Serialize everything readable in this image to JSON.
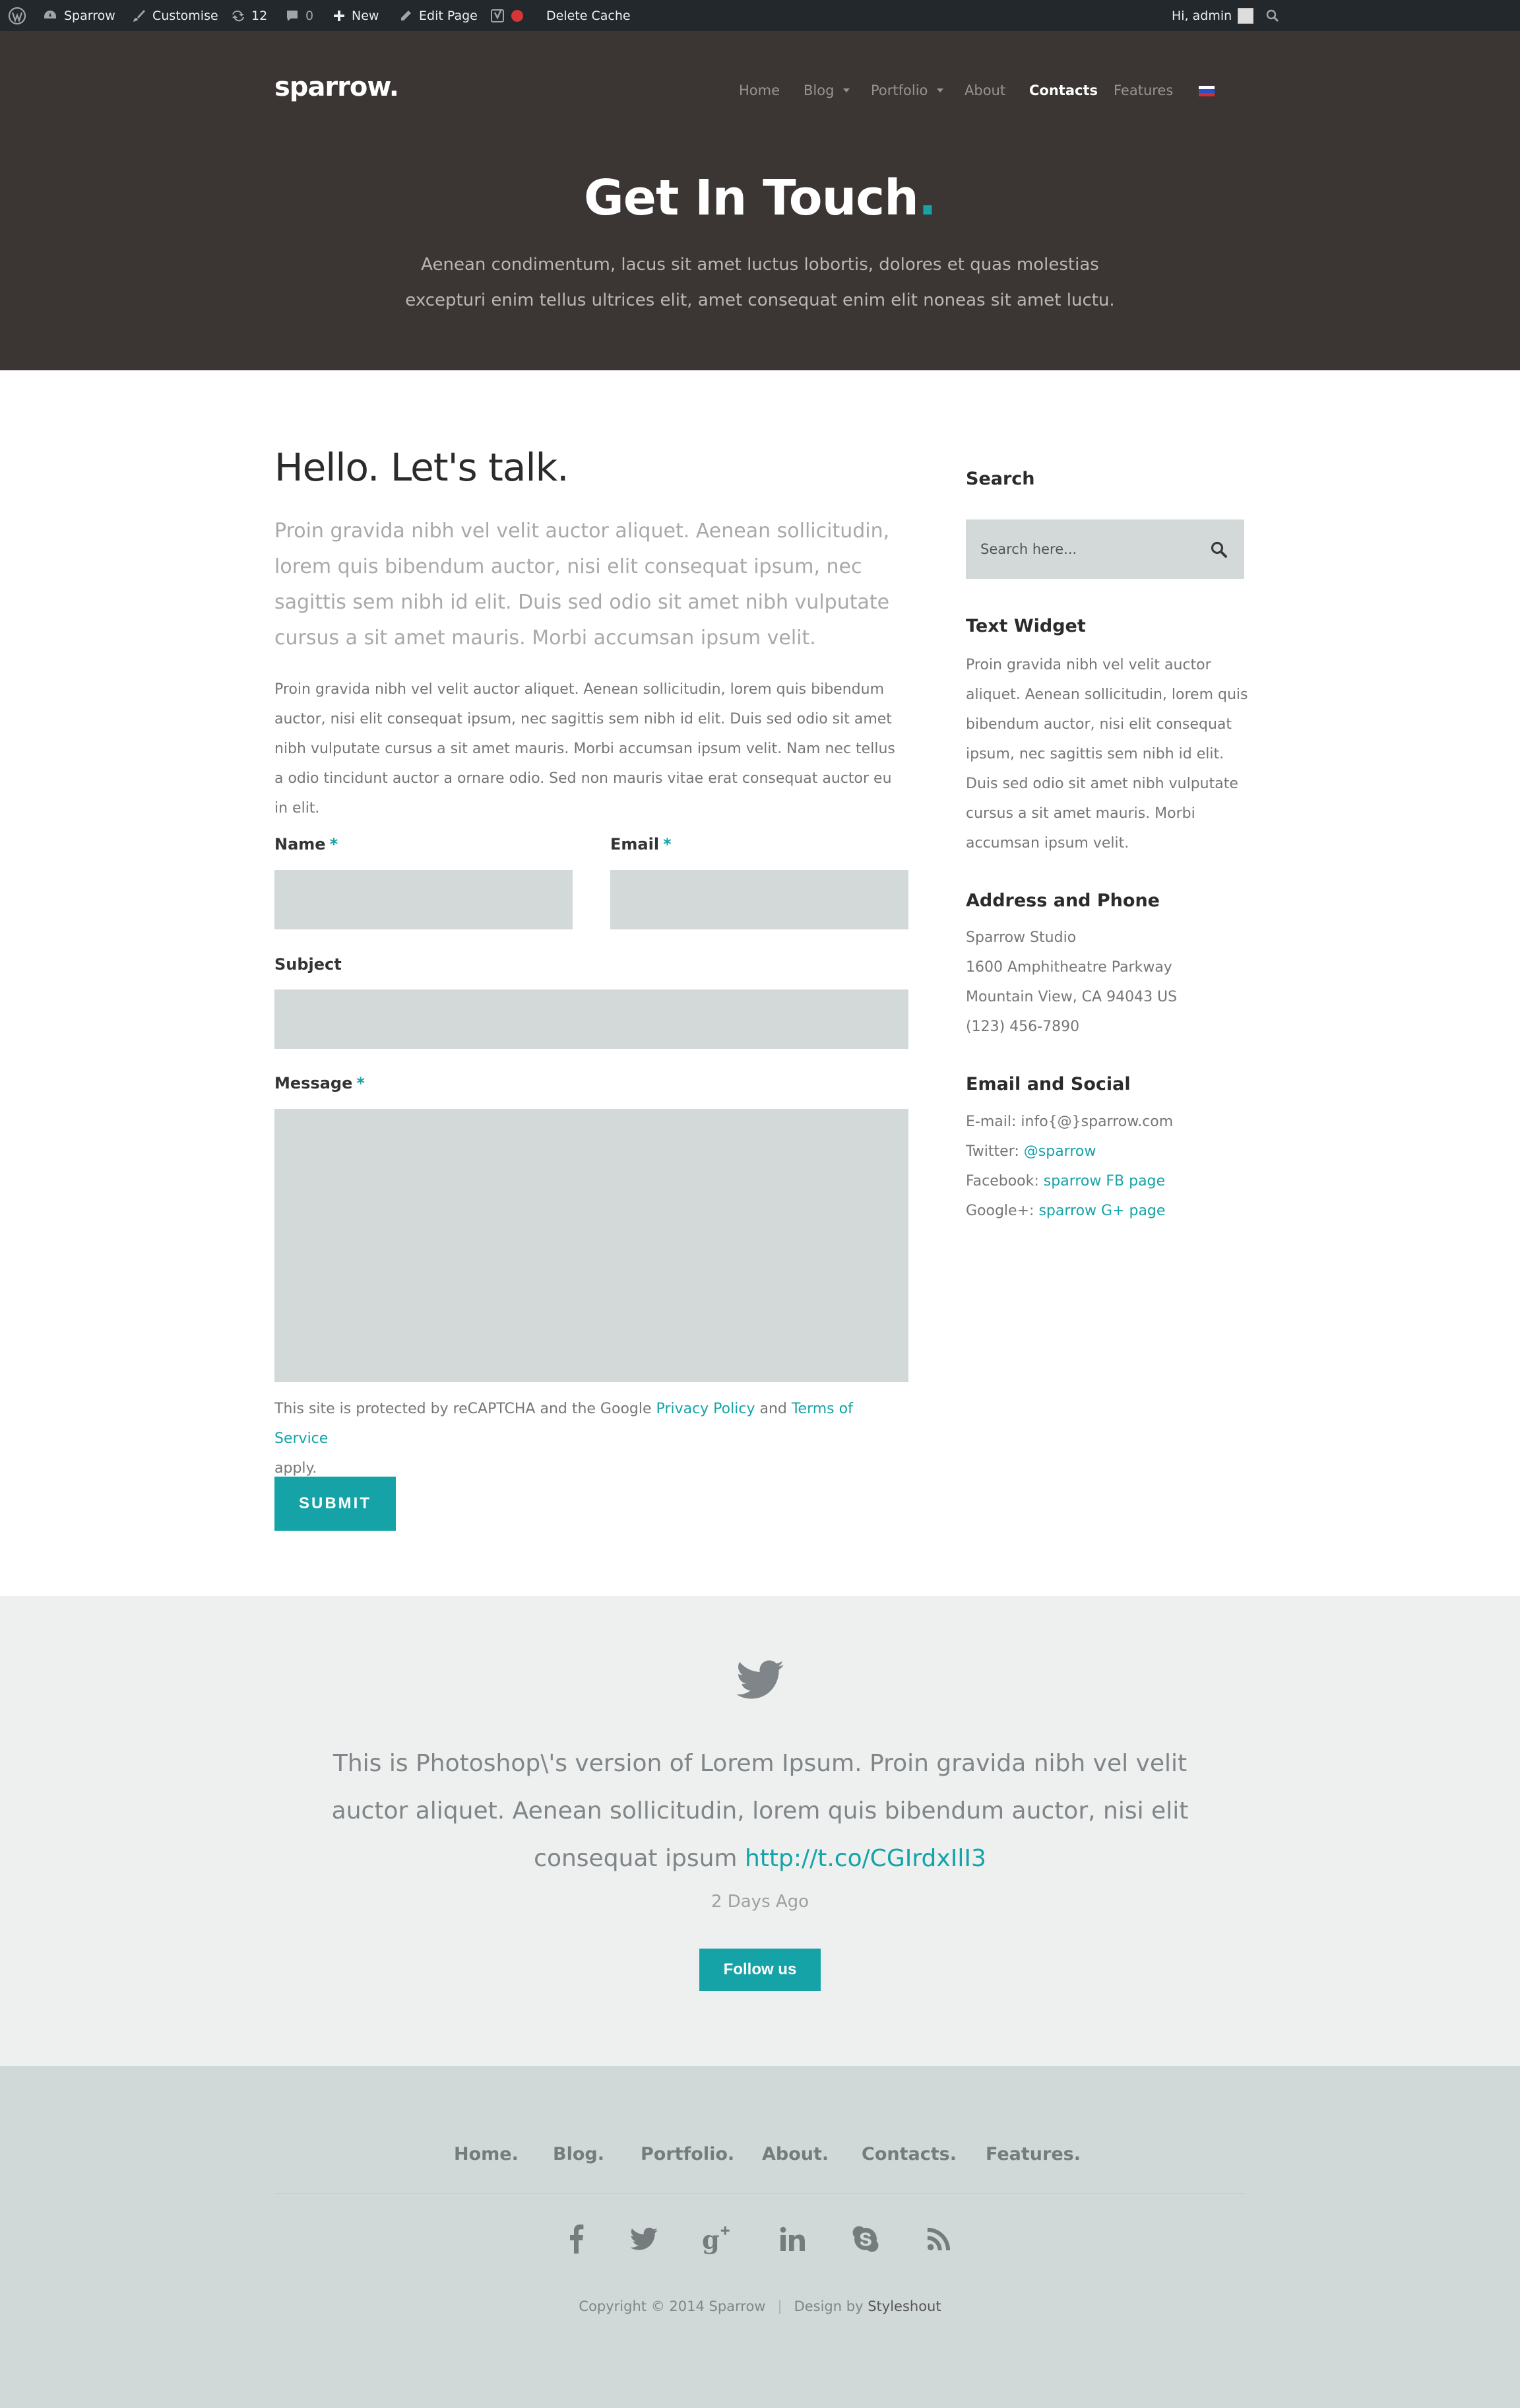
{
  "admin_bar": {
    "site_name": "Sparrow",
    "customise": "Customise",
    "updates": "12",
    "comments": "0",
    "new": "New",
    "edit_page": "Edit Page",
    "delete_cache": "Delete Cache",
    "greeting": "Hi, admin"
  },
  "header": {
    "logo": "sparrow.",
    "nav": [
      "Home",
      "Blog",
      "Portfolio",
      "About",
      "Contacts",
      "Features"
    ],
    "active_nav": "Contacts",
    "title": "Get In Touch",
    "title_dot": ".",
    "intro": "Aenean condimentum, lacus sit amet luctus lobortis, dolores et quas molestias excepturi enim tellus ultrices elit, amet consequat enim elit noneas sit amet luctu."
  },
  "main": {
    "title": "Hello. Let's talk.",
    "lead": "Proin gravida nibh vel velit auctor aliquet. Aenean sollicitudin, lorem quis bibendum auctor, nisi elit consequat ipsum, nec sagittis sem nibh id elit. Duis sed odio sit amet nibh vulputate cursus a sit amet mauris. Morbi accumsan ipsum velit.",
    "body": "Proin gravida nibh vel velit auctor aliquet. Aenean sollicitudin, lorem quis bibendum auctor, nisi elit consequat ipsum, nec sagittis sem nibh id elit. Duis sed odio sit amet nibh vulputate cursus a sit amet mauris. Morbi accumsan ipsum velit. Nam nec tellus a odio tincidunt auctor a ornare odio. Sed non mauris vitae erat consequat auctor eu in elit."
  },
  "form": {
    "name_label": "Name",
    "email_label": "Email",
    "subject_label": "Subject",
    "message_label": "Message",
    "required_mark": "*",
    "recaptcha_prefix": "This site is protected by reCAPTCHA and the Google",
    "privacy_link": "Privacy Policy",
    "and": "and",
    "terms_link": "Terms of Service",
    "recaptcha_suffix": "apply.",
    "submit": "SUBMIT"
  },
  "sidebar": {
    "search_title": "Search",
    "search_placeholder": "Search here...",
    "text_widget_title": "Text Widget",
    "text_widget_body": "Proin gravida nibh vel velit auctor aliquet. Aenean sollicitudin, lorem quis bibendum auctor, nisi elit consequat ipsum, nec sagittis sem nibh id elit. Duis sed odio sit amet nibh vulputate cursus a sit amet mauris. Morbi accumsan ipsum velit.",
    "address_title": "Address and Phone",
    "address_lines": [
      "Sparrow Studio",
      "1600 Amphitheatre Parkway",
      "Mountain View, CA 94043 US",
      "(123) 456-7890"
    ],
    "social_title": "Email and Social",
    "email_label": "E-mail:",
    "email_value": "info{@}sparrow.com",
    "twitter_label": "Twitter:",
    "twitter_value": "@sparrow",
    "facebook_label": "Facebook:",
    "facebook_value": "sparrow FB page",
    "google_label": "Google+:",
    "google_value": "sparrow G+ page"
  },
  "tweet": {
    "text": "This is Photoshop\\'s version of Lorem Ipsum. Proin gravida nibh vel velit auctor aliquet. Aenean sollicitudin, lorem quis bibendum auctor, nisi elit consequat ipsum",
    "link": "http://t.co/CGIrdxIlI3",
    "time": "2 Days Ago",
    "follow": "Follow us"
  },
  "footer": {
    "nav": [
      "Home.",
      "Blog.",
      "Portfolio.",
      "About.",
      "Contacts.",
      "Features."
    ],
    "social_icons": [
      "facebook-icon",
      "twitter-icon",
      "google-plus-icon",
      "linkedin-icon",
      "skype-icon",
      "rss-icon"
    ],
    "copyright": "Copyright © 2014 Sparrow",
    "separator": "|",
    "design_by": "Design by",
    "designer": "Styleshout"
  },
  "colors": {
    "accent": "#15a3a7",
    "hero_bg": "#3b3533",
    "admin_bar_bg": "#23282d",
    "field_bg": "#d3d9d9",
    "tweet_bg": "#eef0ef",
    "footer_bg": "#d1d9d8"
  }
}
